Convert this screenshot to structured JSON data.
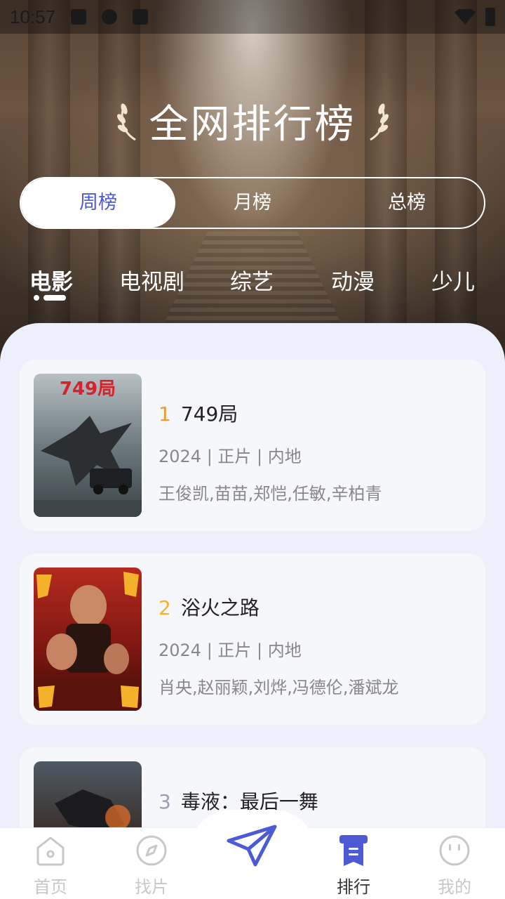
{
  "status_bar": {
    "time": "10:57"
  },
  "header": {
    "title": "全网排行榜"
  },
  "segments": {
    "items": [
      "周榜",
      "月榜",
      "总榜"
    ],
    "active_index": 0
  },
  "categories": {
    "items": [
      "电影",
      "电视剧",
      "综艺",
      "动漫",
      "少儿"
    ],
    "active_index": 0
  },
  "movies": [
    {
      "rank": "1",
      "title": "749局",
      "meta": "2024 | 正片 | 内地",
      "cast": "王俊凯,苗苗,郑恺,任敏,辛柏青",
      "rank_color": "#f39a2c"
    },
    {
      "rank": "2",
      "title": "浴火之路",
      "meta": "2024 | 正片 | 内地",
      "cast": "肖央,赵丽颖,刘烨,冯德伦,潘斌龙",
      "rank_color": "#f6b32a"
    },
    {
      "rank": "3",
      "title": "毒液：最后一舞",
      "meta": "",
      "cast": "",
      "rank_color": "#9aa0b4"
    }
  ],
  "poster_text": {
    "p1": "749局"
  },
  "nav": {
    "items": [
      "首页",
      "找片",
      "排行",
      "我的"
    ],
    "active": "排行",
    "accent": "#4c5ad6"
  }
}
